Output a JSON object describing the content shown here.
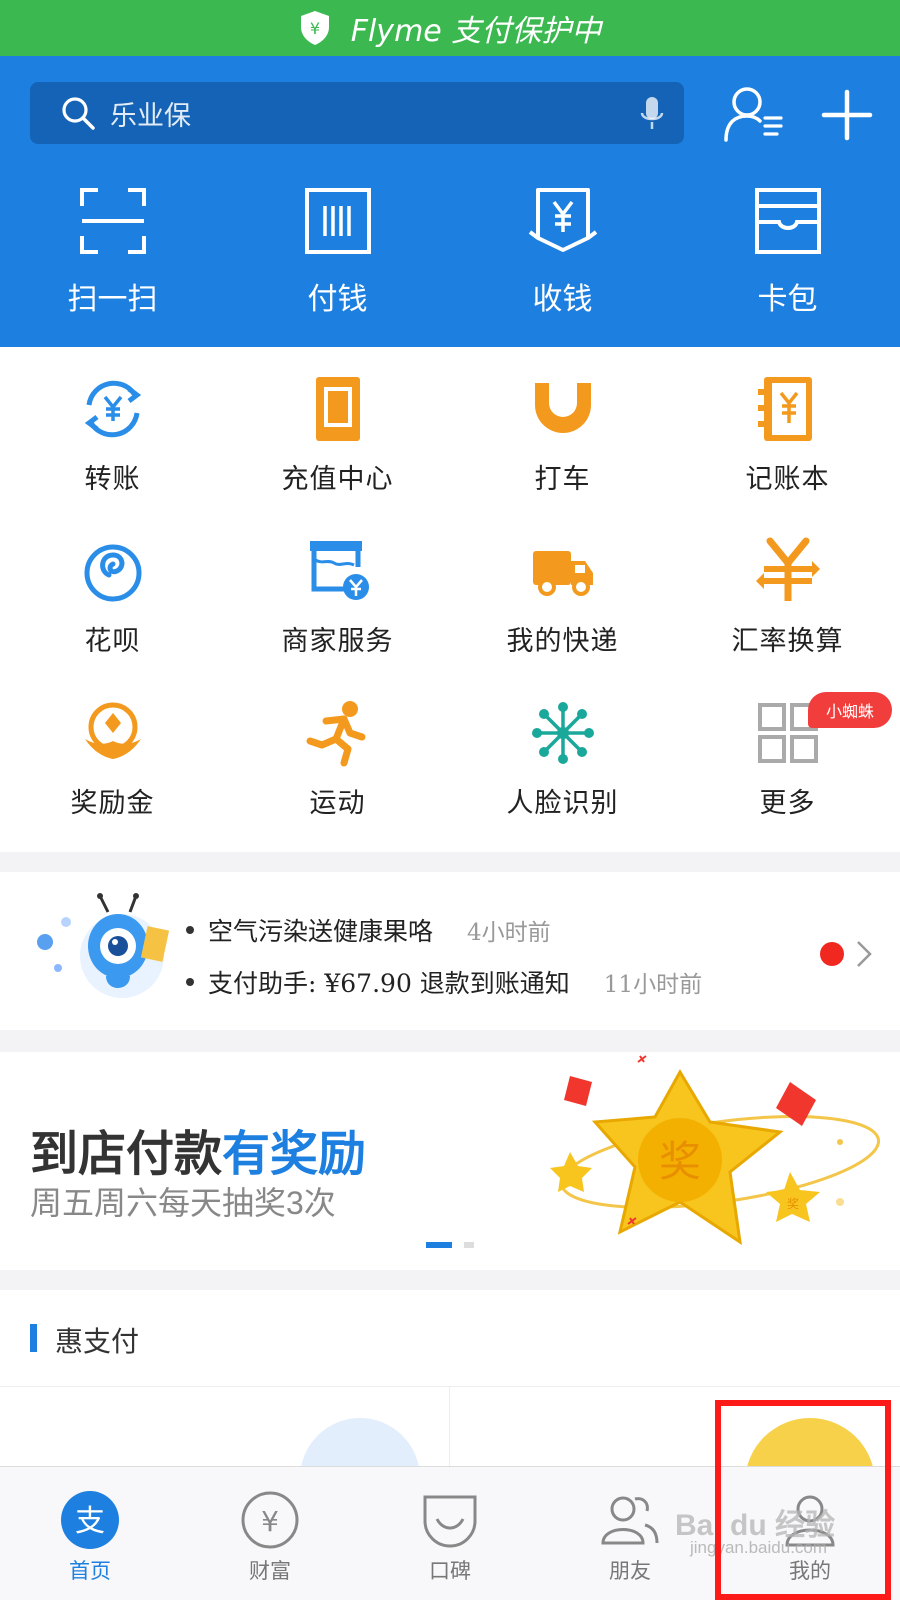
{
  "status_bar": {
    "text": "Flyme 支付保护中",
    "shield_glyph": "¥"
  },
  "search": {
    "placeholder": "乐业保"
  },
  "quick_actions": [
    {
      "label": "扫一扫",
      "icon": "scan-icon"
    },
    {
      "label": "付钱",
      "icon": "barcode-pay-icon"
    },
    {
      "label": "收钱",
      "icon": "receive-money-icon"
    },
    {
      "label": "卡包",
      "icon": "card-wallet-icon"
    }
  ],
  "grid": [
    {
      "label": "转账",
      "icon": "transfer-icon"
    },
    {
      "label": "充值中心",
      "icon": "phone-recharge-icon"
    },
    {
      "label": "打车",
      "icon": "taxi-icon"
    },
    {
      "label": "记账本",
      "icon": "ledger-icon"
    },
    {
      "label": "花呗",
      "icon": "huabei-icon"
    },
    {
      "label": "商家服务",
      "icon": "merchant-icon"
    },
    {
      "label": "我的快递",
      "icon": "delivery-truck-icon"
    },
    {
      "label": "汇率换算",
      "icon": "exchange-rate-icon"
    },
    {
      "label": "奖励金",
      "icon": "reward-icon"
    },
    {
      "label": "运动",
      "icon": "running-icon"
    },
    {
      "label": "人脸识别",
      "icon": "face-recognition-icon"
    },
    {
      "label": "更多",
      "icon": "more-grid-icon"
    }
  ],
  "more_badge": "小蜘蛛",
  "messages": [
    {
      "text": "空气污染送健康果咯",
      "time": "4小时前"
    },
    {
      "text": "支付助手: ¥67.90 退款到账通知",
      "time": "11小时前"
    }
  ],
  "banner": {
    "title_dark": "到店付款",
    "title_blue": "有奖励",
    "subtitle": "周五周六每天抽奖3次",
    "star_text": "奖",
    "small_star_text": "奖"
  },
  "section": {
    "title": "惠支付"
  },
  "tabs": [
    {
      "label": "首页",
      "active": true
    },
    {
      "label": "财富",
      "active": false
    },
    {
      "label": "口碑",
      "active": false
    },
    {
      "label": "朋友",
      "active": false
    },
    {
      "label": "我的",
      "active": false
    }
  ],
  "tab_glyphs": {
    "home": "支",
    "wealth": "¥"
  },
  "watermark": {
    "main": "Bai du 经验",
    "sub": "jingyan.baidu.com"
  },
  "colors": {
    "header_blue": "#1d80e0",
    "status_green": "#3cb850",
    "orange": "#f39a1e",
    "highlight_red": "#ff1a1a"
  }
}
